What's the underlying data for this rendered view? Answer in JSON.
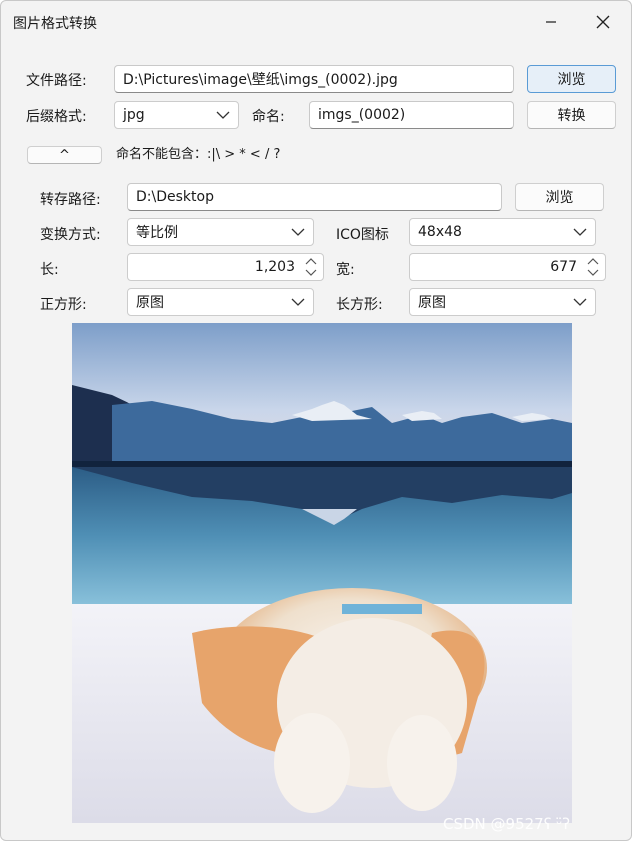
{
  "window": {
    "title": "图片格式转换"
  },
  "file_path": {
    "label": "文件路径:",
    "value": "D:\\Pictures\\image\\壁纸\\imgs_(0002).jpg",
    "browse_label": "浏览"
  },
  "suffix": {
    "label": "后缀格式:",
    "value": "jpg"
  },
  "name": {
    "label": "命名:",
    "value": "imgs_(0002)"
  },
  "convert_label": "转换",
  "collapse_label": "^",
  "name_hint": "命名不能包含：:|\\ > * < / ?",
  "save_path": {
    "label": "转存路径:",
    "value": "D:\\Desktop",
    "browse_label": "浏览"
  },
  "transform": {
    "label": "变换方式:",
    "value": "等比例"
  },
  "ico": {
    "label": "ICO图标",
    "value": "48x48"
  },
  "length": {
    "label": "长:",
    "value": "1,203"
  },
  "width": {
    "label": "宽:",
    "value": "677"
  },
  "square": {
    "label": "正方形:",
    "value": "原图"
  },
  "rect": {
    "label": "长方形:",
    "value": "原图"
  },
  "watermark": "CSDN @9527ʕ ᵕ̈ʔ",
  "icons": [
    "minimize-icon",
    "close-icon",
    "chevron-down-icon",
    "spin-up-icon",
    "spin-down-icon"
  ],
  "colors": {
    "accent": "#5a9bd5",
    "window_bg": "#f3f3f3"
  }
}
